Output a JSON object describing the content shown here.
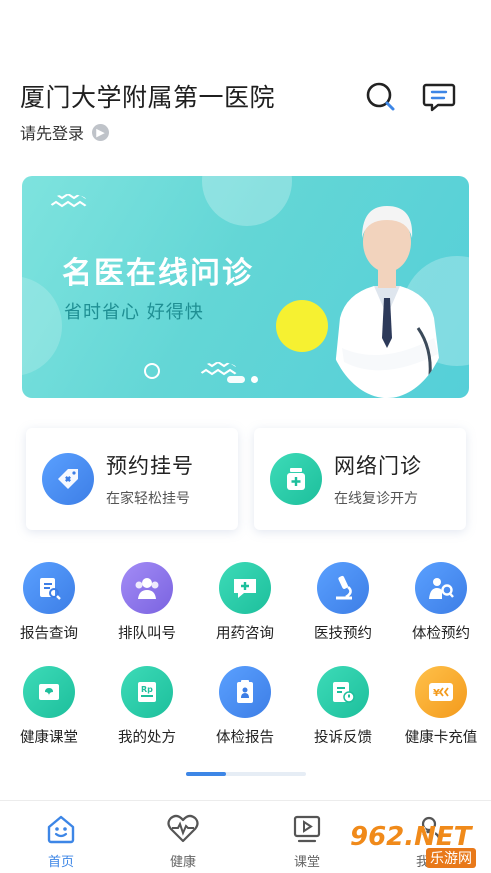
{
  "header": {
    "title": "厦门大学附属第一医院",
    "login_prompt": "请先登录"
  },
  "banner": {
    "title": "名医在线问诊",
    "subtitle": "省时省心 好得快"
  },
  "cards": [
    {
      "title": "预约挂号",
      "subtitle": "在家轻松挂号",
      "icon": "tag-icon",
      "color": "#4a8cf0"
    },
    {
      "title": "网络门诊",
      "subtitle": "在线复诊开方",
      "icon": "medicine-bottle-icon",
      "color": "#23c7a7"
    }
  ],
  "grid": [
    {
      "label": "报告查询",
      "icon": "report-search-icon",
      "color": "#4a8cf0"
    },
    {
      "label": "排队叫号",
      "icon": "queue-icon",
      "color": "#8b76e8"
    },
    {
      "label": "用药咨询",
      "icon": "chat-plus-icon",
      "color": "#23c7a7"
    },
    {
      "label": "医技预约",
      "icon": "microscope-icon",
      "color": "#4a8cf0"
    },
    {
      "label": "体检预约",
      "icon": "person-search-icon",
      "color": "#4a8cf0"
    },
    {
      "label": "健康课堂",
      "icon": "classroom-icon",
      "color": "#23c7a7"
    },
    {
      "label": "我的处方",
      "icon": "prescription-icon",
      "color": "#23c7a7"
    },
    {
      "label": "体检报告",
      "icon": "checkup-report-icon",
      "color": "#4a8cf0"
    },
    {
      "label": "投诉反馈",
      "icon": "feedback-icon",
      "color": "#23c7a7"
    },
    {
      "label": "健康卡充值",
      "icon": "card-recharge-icon",
      "color": "#f5a524"
    }
  ],
  "tabs": [
    {
      "label": "首页",
      "icon": "home-smile-icon",
      "active": true
    },
    {
      "label": "健康",
      "icon": "heartbeat-icon",
      "active": false
    },
    {
      "label": "课堂",
      "icon": "video-play-icon",
      "active": false
    },
    {
      "label": "我的",
      "icon": "profile-icon",
      "active": false
    }
  ],
  "watermark": {
    "text": "962.NET",
    "subtext": "乐游网"
  },
  "colors": {
    "accent": "#3d86e6",
    "banner_bg": "#63d6d6"
  }
}
